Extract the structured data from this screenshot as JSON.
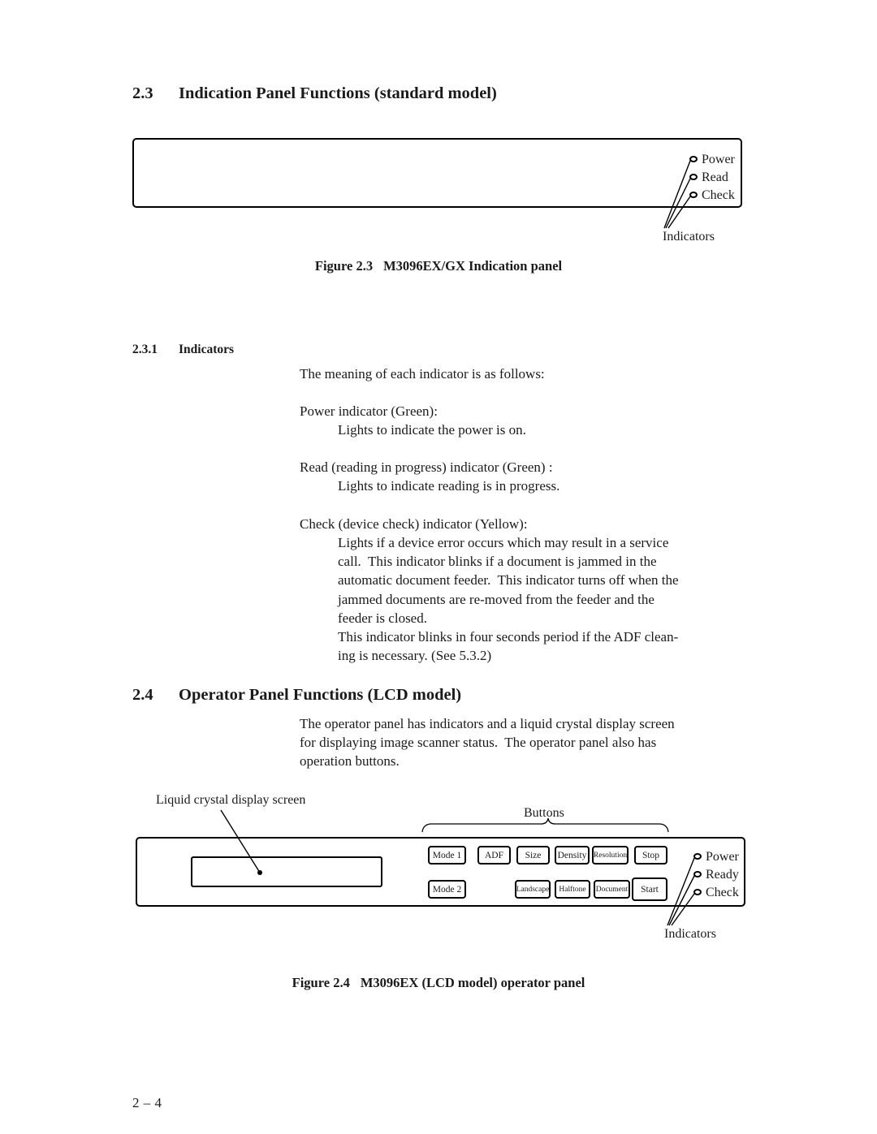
{
  "page": {
    "number": "2 – 4"
  },
  "section_23": {
    "number": "2.3",
    "title": "Indication Panel Functions (standard model)",
    "figure": {
      "caption_label": "Figure 2.3",
      "caption_text": "M3096EX/GX Indication panel",
      "indicator_labels": [
        "Power",
        "Read",
        "Check"
      ],
      "callout": "Indicators"
    }
  },
  "section_231": {
    "number": "2.3.1",
    "title": "Indicators",
    "intro": "The meaning of each indicator is as follows:",
    "entries": [
      {
        "heading": "Power indicator (Green):",
        "body": "Lights to indicate the power is on."
      },
      {
        "heading": "Read (reading in progress) indicator (Green) :",
        "body": "Lights to indicate reading is in progress."
      },
      {
        "heading": "Check (device check) indicator (Yellow):",
        "body": "Lights if a device error occurs which may result in a service\ncall.  This indicator blinks if a document is jammed in the\nautomatic document feeder.  This indicator turns off when the\njammed documents are re-moved from the feeder and the\nfeeder is closed.\nThis indicator blinks in four seconds period if the ADF clean-\ning is necessary. (See 5.3.2)"
      }
    ]
  },
  "section_24": {
    "number": "2.4",
    "title": "Operator Panel Functions (LCD model)",
    "body": "The operator panel has indicators and a liquid crystal display screen\nfor displaying image scanner status.  The operator panel also has\noperation buttons.",
    "figure": {
      "caption_label": "Figure 2.4",
      "caption_text": "M3096EX (LCD model) operator panel",
      "lcd_callout": "Liquid crystal display screen",
      "buttons_callout": "Buttons",
      "indicator_labels": [
        "Power",
        "Ready",
        "Check"
      ],
      "indicators_callout": "Indicators",
      "buttons_row_top": [
        "Mode 1",
        "ADF",
        "Size",
        "Density",
        "Resolution",
        "Stop"
      ],
      "buttons_row_bottom": [
        "Mode 2",
        "Landscape",
        "Halftone",
        "Document",
        "Start"
      ]
    }
  },
  "colors": {
    "ink": "#1a1a1a",
    "line": "#000000",
    "paper": "#ffffff"
  }
}
